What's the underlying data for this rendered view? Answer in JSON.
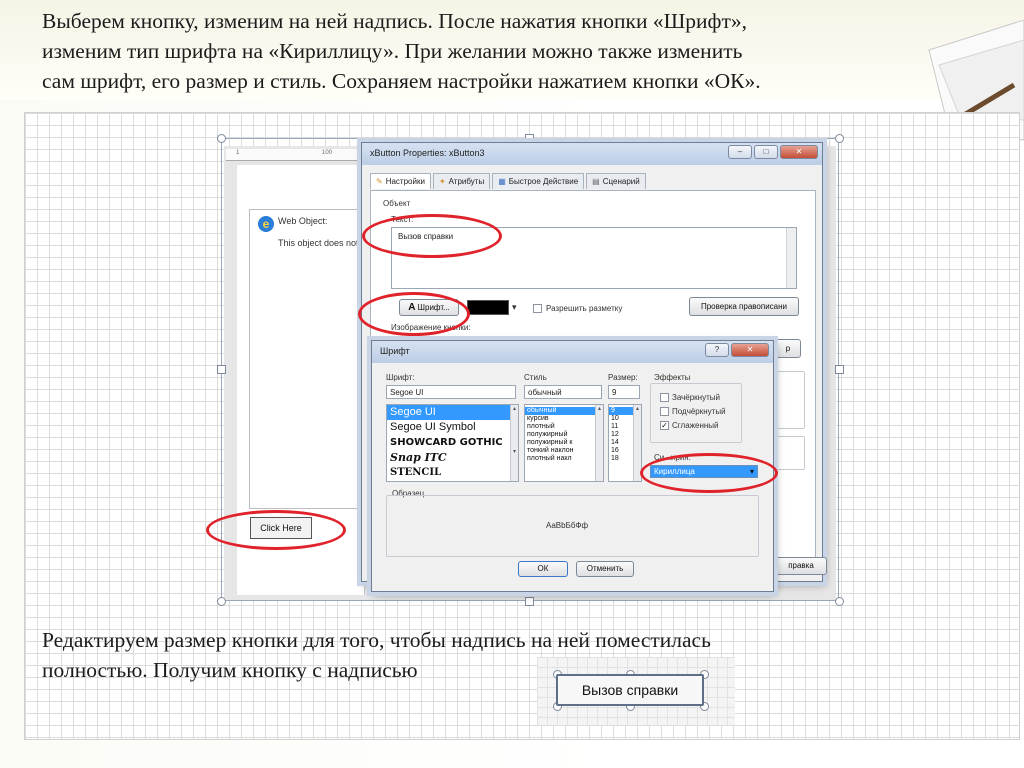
{
  "slide": {
    "intro": "Выберем кнопку, изменим на ней надпись. После нажатия кнопки «Шрифт»,\nизменим тип шрифта на «Кириллицу».  При желании можно также изменить\nсам шрифт, его размер и стиль. Сохраняем настройки нажатием кнопки «ОК».",
    "outro": "Редактируем размер кнопки для того, чтобы надпись на ней поместилась\nполностью. Получим  кнопку с надписью"
  },
  "designer": {
    "ruler_marks": [
      "1",
      "100"
    ],
    "web_object_title": "Web Object:",
    "web_object_body": "This object does not",
    "click_here": "Click Here"
  },
  "props_window": {
    "title": "xButton Properties: xButton3",
    "tabs": [
      {
        "label": "Настройки",
        "icon": "pencil-icon"
      },
      {
        "label": "Атрибуты",
        "icon": "wand-icon"
      },
      {
        "label": "Быстрое Действие",
        "icon": "action-icon"
      },
      {
        "label": "Сценарий",
        "icon": "script-icon"
      }
    ],
    "object_label": "Объект",
    "text_label": "Текст:",
    "text_value": "Вызов справки",
    "font_button": "Шрифт...",
    "allow_markup": "Разрешить разметку",
    "spellcheck_button": "Проверка правописани",
    "image_label": "Изображение кнопки:",
    "right_button_cut": "р",
    "bottom_button_cut": "правка"
  },
  "font_dialog": {
    "title": "Шрифт",
    "font_label": "Шрифт:",
    "font_value": "Segoe UI",
    "fonts": [
      "Segoe UI",
      "Segoe UI Symbol",
      "SHOWCARD GOTHIC",
      "Snap ITC",
      "STENCIL"
    ],
    "style_label": "Стиль",
    "style_value": "обычный",
    "styles": [
      "обычный",
      "курсив",
      "плотный",
      "полужирный",
      "полужирный к",
      "тонкий наклон",
      "плотный накл"
    ],
    "size_label": "Размер:",
    "size_value": "9",
    "sizes": [
      "9",
      "10",
      "11",
      "12",
      "14",
      "16",
      "18"
    ],
    "effects_label": "Эффекты",
    "effects": [
      {
        "label": "Зачёркнутый",
        "checked": false
      },
      {
        "label": "Подчёркнутый",
        "checked": false
      },
      {
        "label": "Сглаженный",
        "checked": true
      }
    ],
    "charset_label": "Cи...ирия:",
    "charset_value": "Кириллица",
    "sample_label": "Образец",
    "sample_text": "AaBbБбФф",
    "ok": "ОК",
    "cancel": "Отменить"
  },
  "result": {
    "button_label": "Вызов справки"
  },
  "colors": {
    "highlight_red": "#e0232a",
    "selection_blue": "#3399ff"
  }
}
